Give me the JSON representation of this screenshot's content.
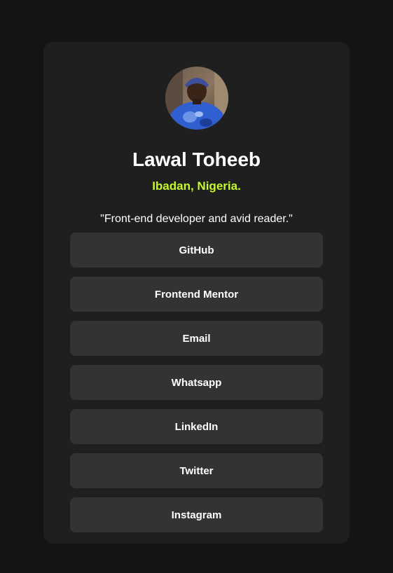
{
  "profile": {
    "name": "Lawal Toheeb",
    "location": "Ibadan, Nigeria.",
    "bio": "\"Front-end developer and avid reader.\"",
    "avatar_icon": "profile-photo"
  },
  "links": [
    {
      "label": "GitHub"
    },
    {
      "label": "Frontend Mentor"
    },
    {
      "label": "Email"
    },
    {
      "label": "Whatsapp"
    },
    {
      "label": "LinkedIn"
    },
    {
      "label": "Twitter"
    },
    {
      "label": "Instagram"
    }
  ],
  "colors": {
    "page_background": "#141414",
    "card_background": "#1f1f1f",
    "button_background": "#333333",
    "accent": "#c4f82a",
    "text": "#ffffff"
  }
}
